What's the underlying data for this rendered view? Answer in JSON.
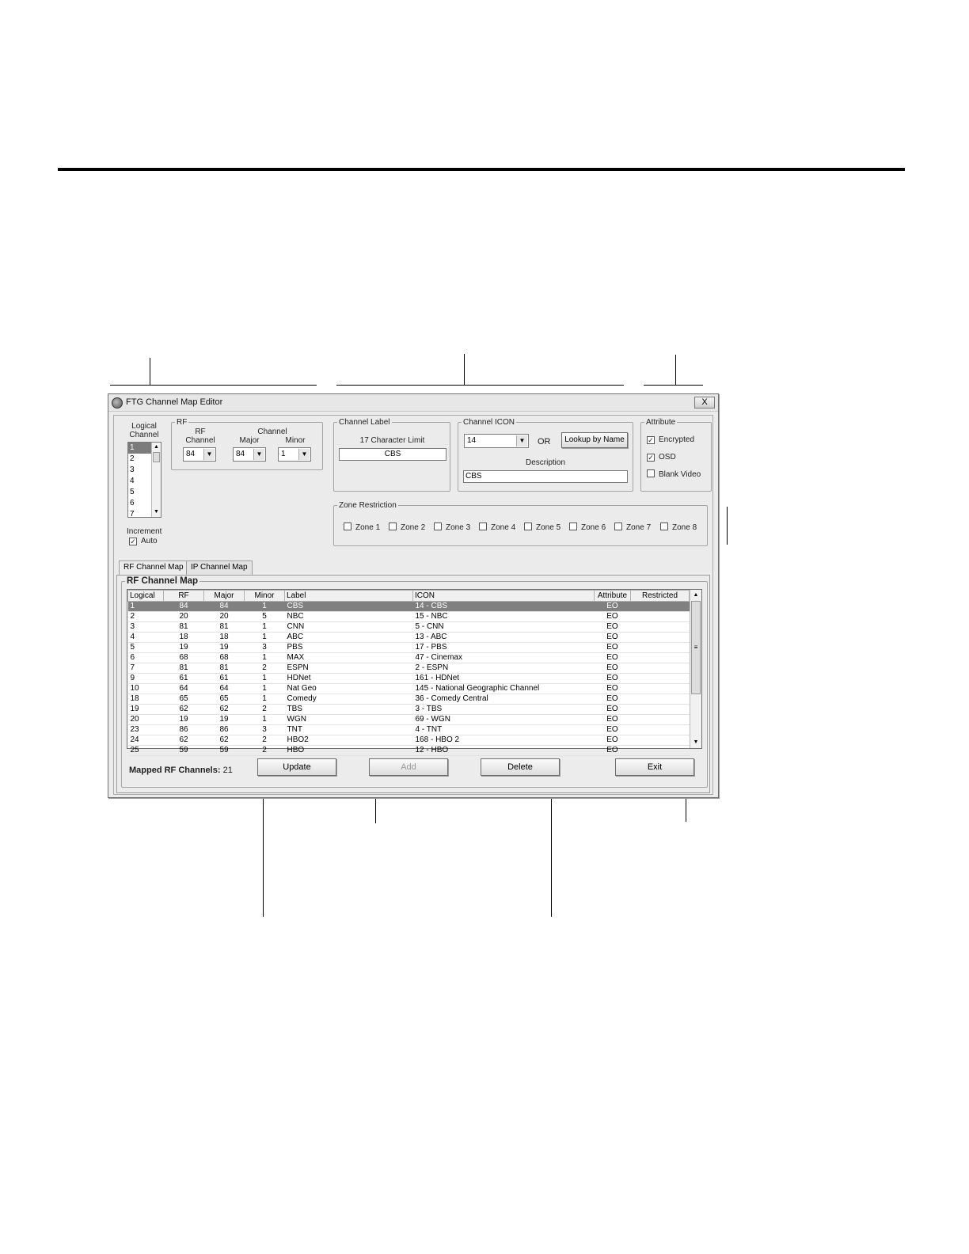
{
  "window": {
    "title": "FTG Channel Map Editor",
    "close_label": "X"
  },
  "logical": {
    "label_line1": "Logical",
    "label_line2": "Channel",
    "items": [
      "1",
      "2",
      "3",
      "4",
      "5",
      "6",
      "7"
    ],
    "selected": "1",
    "increment_label": "Increment",
    "auto_label": "Auto",
    "auto_checked": true
  },
  "rf_group": {
    "legend": "RF",
    "rf_label_line1": "RF",
    "rf_label_line2": "Channel",
    "rf_value": "84",
    "channel_label": "Channel",
    "major_label": "Major",
    "major_value": "84",
    "minor_label": "Minor",
    "minor_value": "1"
  },
  "channel_label_group": {
    "legend": "Channel Label",
    "limit_text": "17 Character Limit",
    "value": "CBS"
  },
  "channel_icon_group": {
    "legend": "Channel ICON",
    "icon_value": "14",
    "or_text": "OR",
    "lookup_button": "Lookup by Name",
    "description_label": "Description",
    "description_value": "CBS"
  },
  "attribute_group": {
    "legend": "Attribute",
    "options": [
      {
        "label": "Encrypted",
        "checked": true
      },
      {
        "label": "OSD",
        "checked": true
      },
      {
        "label": "Blank Video",
        "checked": false
      }
    ]
  },
  "zone_group": {
    "legend": "Zone Restriction",
    "zones": [
      "Zone 1",
      "Zone 2",
      "Zone 3",
      "Zone 4",
      "Zone 5",
      "Zone 6",
      "Zone 7",
      "Zone 8"
    ]
  },
  "tabs": [
    {
      "label": "RF Channel Map",
      "active": true
    },
    {
      "label": "IP Channel Map",
      "active": false
    }
  ],
  "map_group": {
    "legend": "RF Channel Map",
    "columns": [
      "Logical",
      "RF",
      "Major",
      "Minor",
      "Label",
      "ICON",
      "Attribute",
      "Restricted"
    ],
    "rows": [
      [
        "1",
        "84",
        "84",
        "1",
        "CBS",
        "14 - CBS",
        "EO",
        ""
      ],
      [
        "2",
        "20",
        "20",
        "5",
        "NBC",
        "15 - NBC",
        "EO",
        ""
      ],
      [
        "3",
        "81",
        "81",
        "1",
        "CNN",
        "5 - CNN",
        "EO",
        ""
      ],
      [
        "4",
        "18",
        "18",
        "1",
        "ABC",
        "13 - ABC",
        "EO",
        ""
      ],
      [
        "5",
        "19",
        "19",
        "3",
        "PBS",
        "17 - PBS",
        "EO",
        ""
      ],
      [
        "6",
        "68",
        "68",
        "1",
        "MAX",
        "47 - Cinemax",
        "EO",
        ""
      ],
      [
        "7",
        "81",
        "81",
        "2",
        "ESPN",
        "2 - ESPN",
        "EO",
        ""
      ],
      [
        "9",
        "61",
        "61",
        "1",
        "HDNet",
        "161 - HDNet",
        "EO",
        ""
      ],
      [
        "10",
        "64",
        "64",
        "1",
        "Nat Geo",
        "145 - National Geographic Channel",
        "EO",
        ""
      ],
      [
        "18",
        "65",
        "65",
        "1",
        "Comedy",
        "36 - Comedy Central",
        "EO",
        ""
      ],
      [
        "19",
        "62",
        "62",
        "2",
        "TBS",
        "3 - TBS",
        "EO",
        ""
      ],
      [
        "20",
        "19",
        "19",
        "1",
        "WGN",
        "69 - WGN",
        "EO",
        ""
      ],
      [
        "23",
        "86",
        "86",
        "3",
        "TNT",
        "4 - TNT",
        "EO",
        ""
      ],
      [
        "24",
        "62",
        "62",
        "2",
        "HBO2",
        "168 - HBO 2",
        "EO",
        ""
      ],
      [
        "25",
        "59",
        "59",
        "2",
        "HBO",
        "12 - HBO",
        "EO",
        ""
      ]
    ],
    "mapped_label": "Mapped RF Channels:",
    "mapped_count": "21"
  },
  "buttons": {
    "update": "Update",
    "add": "Add",
    "delete": "Delete",
    "exit": "Exit"
  }
}
